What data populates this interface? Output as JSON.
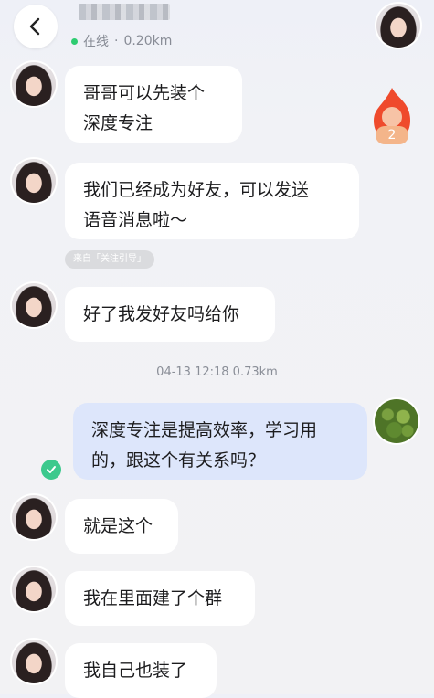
{
  "header": {
    "status_text": "在线",
    "distance": "0.20km"
  },
  "flame_badge": {
    "count": "2"
  },
  "messages": [
    {
      "side": "left",
      "text_line1": "哥哥可以先装个",
      "text_line2": "深度专注"
    },
    {
      "side": "left",
      "text_line1": "我们已经成为好友，可以发送",
      "text_line2": "语音消息啦～"
    },
    {
      "side": "left",
      "text": "好了我发好友吗给你"
    },
    {
      "side": "right",
      "text_line1": "深度专注是提高效率，学习用",
      "text_line2": "的，跟这个有关系吗？"
    },
    {
      "side": "left",
      "text": "就是这个"
    },
    {
      "side": "left",
      "text": "我在里面建了个群"
    },
    {
      "side": "left",
      "text": "我自己也装了"
    }
  ],
  "source_tag": "来自「关注引导」",
  "timestamp": "04-13 12:18  0.73km",
  "colors": {
    "online": "#2ecc71",
    "my_bubble": "#dde6fb",
    "their_bubble": "#ffffff",
    "read_check": "#3cc98d",
    "flame": "#ef4a2c"
  }
}
